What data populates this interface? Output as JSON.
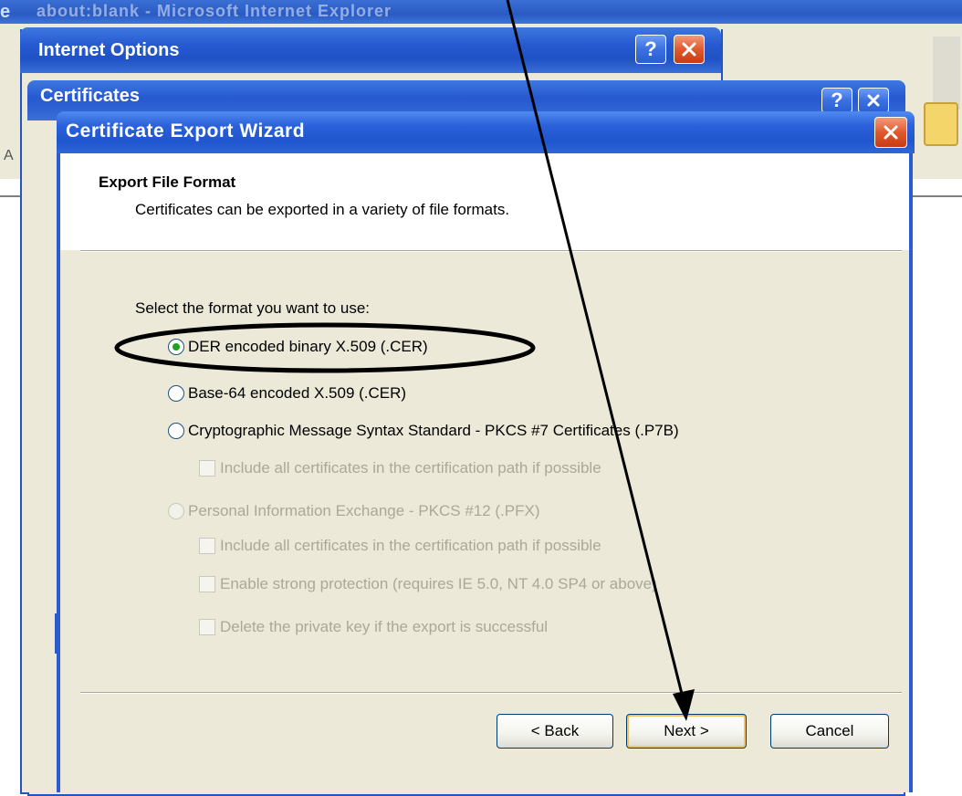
{
  "background_window": {
    "title": "about:blank - Microsoft Internet Explorer",
    "left_label": "A"
  },
  "internet_options": {
    "title": "Internet Options",
    "help_label": "?"
  },
  "certificates": {
    "title": "Certificates",
    "help_label": "?"
  },
  "wizard": {
    "title": "Certificate Export Wizard",
    "header": {
      "title": "Export File Format",
      "subtitle": "Certificates can be exported in a variety of file formats."
    },
    "prompt": "Select the format you want to use:",
    "options": {
      "der": {
        "label": "DER encoded binary X.509 (.CER)",
        "selected": true,
        "enabled": true
      },
      "base64": {
        "label": "Base-64 encoded X.509 (.CER)",
        "selected": false,
        "enabled": true
      },
      "pkcs7": {
        "label": "Cryptographic Message Syntax Standard - PKCS #7 Certificates (.P7B)",
        "selected": false,
        "enabled": true
      },
      "pfx": {
        "label": "Personal Information Exchange - PKCS #12 (.PFX)",
        "selected": false,
        "enabled": false
      }
    },
    "checkboxes": {
      "p7_include_path": {
        "label": "Include all certificates in the certification path if possible",
        "checked": false,
        "enabled": false
      },
      "pfx_include_path": {
        "label": "Include all certificates in the certification path if possible",
        "checked": false,
        "enabled": false
      },
      "strong_protection": {
        "label": "Enable strong protection (requires IE 5.0, NT 4.0 SP4 or above)",
        "checked": false,
        "enabled": false
      },
      "delete_key": {
        "label": "Delete the private key if the export is successful",
        "checked": false,
        "enabled": false
      }
    },
    "buttons": {
      "back": "< Back",
      "next": "Next >",
      "cancel": "Cancel"
    }
  },
  "annotations": {
    "highlight_target": "DER encoded binary X.509 (.CER)",
    "arrow_target": "Next >",
    "color": "#000000"
  },
  "colors": {
    "xp_title_blue": "#2658cf",
    "dialog_face": "#ece9d8",
    "close_red": "#e05a2e",
    "radio_selected": "#21a121",
    "disabled_text": "#aca899"
  }
}
